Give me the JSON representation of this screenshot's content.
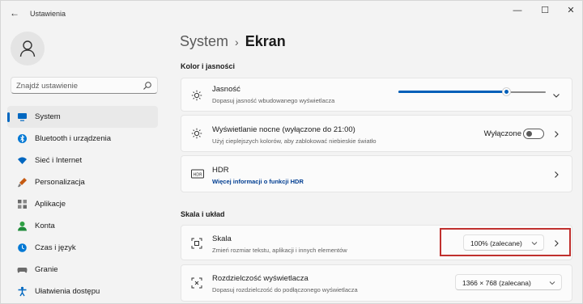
{
  "window": {
    "app_title": "Ustawienia",
    "controls": {
      "minimize": "—",
      "maximize": "☐",
      "close": "✕"
    },
    "back_glyph": "←"
  },
  "sidebar": {
    "search_placeholder": "Znajdź ustawienie",
    "items": [
      {
        "label": "System",
        "icon": "monitor-icon",
        "active": true,
        "color": "#0067c0"
      },
      {
        "label": "Bluetooth i urządzenia",
        "icon": "bluetooth-icon",
        "color": "#0078d4"
      },
      {
        "label": "Sieć i Internet",
        "icon": "wifi-icon",
        "color": "#0067c0"
      },
      {
        "label": "Personalizacja",
        "icon": "brush-icon",
        "color": "#c55a11"
      },
      {
        "label": "Aplikacje",
        "icon": "apps-icon",
        "color": "#6b6b6b"
      },
      {
        "label": "Konta",
        "icon": "person-icon",
        "color": "#2ea043"
      },
      {
        "label": "Czas i język",
        "icon": "globe-clock-icon",
        "color": "#0078d4"
      },
      {
        "label": "Granie",
        "icon": "gamepad-icon",
        "color": "#6b6b6b"
      },
      {
        "label": "Ułatwienia dostępu",
        "icon": "accessibility-icon",
        "color": "#0067c0"
      }
    ]
  },
  "breadcrumb": {
    "parent": "System",
    "separator": "›",
    "current": "Ekran"
  },
  "sections": {
    "color": "Kolor i jasności",
    "scale": "Skala i układ"
  },
  "cards": {
    "brightness": {
      "title": "Jasność",
      "subtitle": "Dopasuj jasność wbudowanego wyświetlacza",
      "value": 0.73
    },
    "night_light": {
      "title": "Wyświetlanie nocne (wyłączone do 21:00)",
      "subtitle": "Użyj cieplejszych kolorów, aby zablokować niebieskie światło",
      "state_label": "Wyłączone"
    },
    "hdr": {
      "title": "HDR",
      "link": "Więcej informacji o funkcji HDR",
      "badge": "HDR"
    },
    "scale": {
      "title": "Skala",
      "subtitle": "Zmień rozmiar tekstu, aplikacji i innych elementów",
      "value": "100% (zalecane)"
    },
    "resolution": {
      "title": "Rozdzielczość wyświetlacza",
      "subtitle": "Dopasuj rozdzielczość do podłączonego wyświetlacza",
      "value": "1366 × 768 (zalecana)"
    }
  },
  "colors": {
    "accent": "#005fb8",
    "highlight_box": "#c0302e"
  }
}
